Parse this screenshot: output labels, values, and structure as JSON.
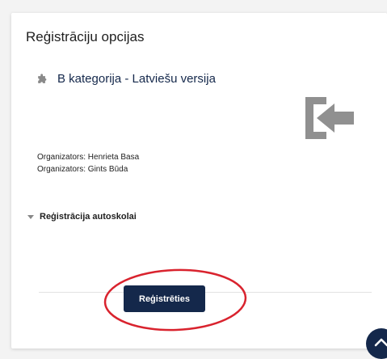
{
  "card": {
    "title": "Reģistrāciju opcijas"
  },
  "course": {
    "icon": "puzzle-piece-icon",
    "name": "B kategorija - Latviešu versija",
    "enrol_icon": "sign-in-arrow-icon"
  },
  "organizers": [
    "Organizators: Henrieta Basa",
    "Organizators: Gints Būda"
  ],
  "section": {
    "label": "Reģistrācija autoskolai",
    "expanded": false
  },
  "register_button": {
    "label": "Reģistrēties"
  },
  "colors": {
    "primary": "#14284b",
    "annotation": "#d9232e",
    "icon_gray": "#909090"
  },
  "scroll_top": {
    "icon": "chevron-up-icon"
  }
}
